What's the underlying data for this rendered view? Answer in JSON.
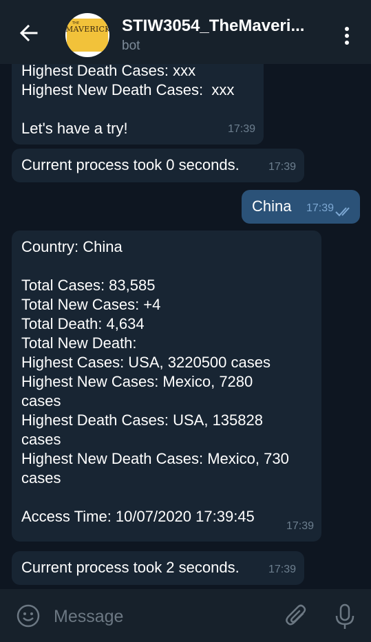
{
  "header": {
    "title": "STIW3054_TheMaveri...",
    "subtitle": "bot",
    "avatar_text": "MAVERICKS",
    "avatar_small": "THE"
  },
  "messages": [
    {
      "direction": "in",
      "text": "Highest Death Cases: xxx\nHighest New Death Cases:  xxx\n\nLet's have a try!",
      "time": "17:39"
    },
    {
      "direction": "in",
      "text": "Current process took 0 seconds.",
      "time": "17:39"
    },
    {
      "direction": "out",
      "text": "China",
      "time": "17:39",
      "status_icon": "double-check-icon"
    },
    {
      "direction": "in",
      "text": "Country: China\n\nTotal Cases: 83,585\nTotal New Cases: +4\nTotal Death: 4,634\nTotal New Death:\nHighest Cases: USA, 3220500 cases\nHighest New Cases: Mexico, 7280\ncases\nHighest Death Cases: USA, 135828\ncases\nHighest New Death Cases: Mexico, 730\ncases\n\nAccess Time: 10/07/2020 17:39:45",
      "time": "17:39"
    },
    {
      "direction": "in",
      "text": "Current process took 2 seconds.",
      "time": "17:39"
    }
  ],
  "input": {
    "placeholder": "Message",
    "value": ""
  },
  "icons": {
    "back": "arrow-left-icon",
    "menu": "more-vertical-icon",
    "emoji": "emoji-icon",
    "attach": "paperclip-icon",
    "mic": "microphone-icon"
  },
  "colors": {
    "header_bg": "#17212b",
    "chat_bg": "#0e1621",
    "bubble_in": "#182533",
    "bubble_out": "#2b5278",
    "timestamp": "#6d7f8f",
    "accent_tick": "#7da8d3"
  }
}
